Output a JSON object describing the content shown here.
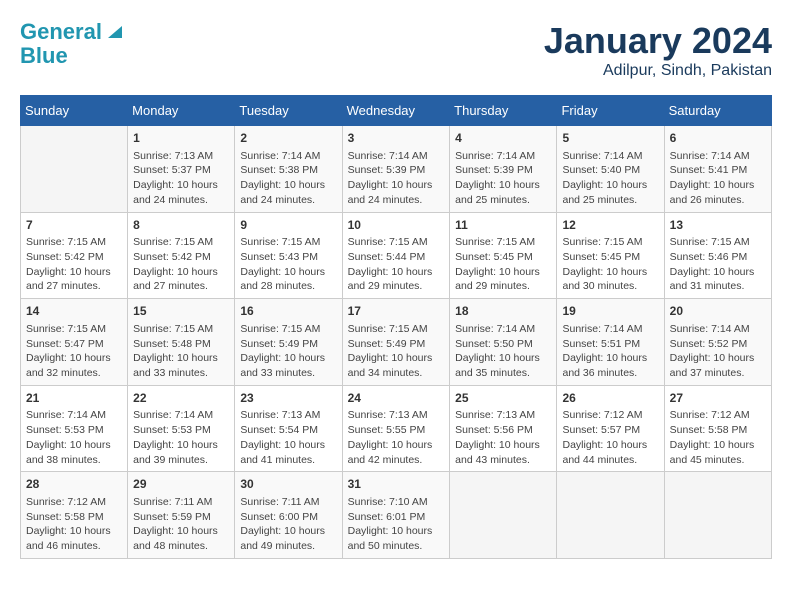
{
  "header": {
    "logo_line1": "General",
    "logo_line2": "Blue",
    "title": "January 2024",
    "subtitle": "Adilpur, Sindh, Pakistan"
  },
  "weekdays": [
    "Sunday",
    "Monday",
    "Tuesday",
    "Wednesday",
    "Thursday",
    "Friday",
    "Saturday"
  ],
  "weeks": [
    [
      {
        "day": "",
        "sunrise": "",
        "sunset": "",
        "daylight": ""
      },
      {
        "day": "1",
        "sunrise": "7:13 AM",
        "sunset": "5:37 PM",
        "daylight": "10 hours and 24 minutes."
      },
      {
        "day": "2",
        "sunrise": "7:14 AM",
        "sunset": "5:38 PM",
        "daylight": "10 hours and 24 minutes."
      },
      {
        "day": "3",
        "sunrise": "7:14 AM",
        "sunset": "5:39 PM",
        "daylight": "10 hours and 24 minutes."
      },
      {
        "day": "4",
        "sunrise": "7:14 AM",
        "sunset": "5:39 PM",
        "daylight": "10 hours and 25 minutes."
      },
      {
        "day": "5",
        "sunrise": "7:14 AM",
        "sunset": "5:40 PM",
        "daylight": "10 hours and 25 minutes."
      },
      {
        "day": "6",
        "sunrise": "7:14 AM",
        "sunset": "5:41 PM",
        "daylight": "10 hours and 26 minutes."
      }
    ],
    [
      {
        "day": "7",
        "sunrise": "7:15 AM",
        "sunset": "5:42 PM",
        "daylight": "10 hours and 27 minutes."
      },
      {
        "day": "8",
        "sunrise": "7:15 AM",
        "sunset": "5:42 PM",
        "daylight": "10 hours and 27 minutes."
      },
      {
        "day": "9",
        "sunrise": "7:15 AM",
        "sunset": "5:43 PM",
        "daylight": "10 hours and 28 minutes."
      },
      {
        "day": "10",
        "sunrise": "7:15 AM",
        "sunset": "5:44 PM",
        "daylight": "10 hours and 29 minutes."
      },
      {
        "day": "11",
        "sunrise": "7:15 AM",
        "sunset": "5:45 PM",
        "daylight": "10 hours and 29 minutes."
      },
      {
        "day": "12",
        "sunrise": "7:15 AM",
        "sunset": "5:45 PM",
        "daylight": "10 hours and 30 minutes."
      },
      {
        "day": "13",
        "sunrise": "7:15 AM",
        "sunset": "5:46 PM",
        "daylight": "10 hours and 31 minutes."
      }
    ],
    [
      {
        "day": "14",
        "sunrise": "7:15 AM",
        "sunset": "5:47 PM",
        "daylight": "10 hours and 32 minutes."
      },
      {
        "day": "15",
        "sunrise": "7:15 AM",
        "sunset": "5:48 PM",
        "daylight": "10 hours and 33 minutes."
      },
      {
        "day": "16",
        "sunrise": "7:15 AM",
        "sunset": "5:49 PM",
        "daylight": "10 hours and 33 minutes."
      },
      {
        "day": "17",
        "sunrise": "7:15 AM",
        "sunset": "5:49 PM",
        "daylight": "10 hours and 34 minutes."
      },
      {
        "day": "18",
        "sunrise": "7:14 AM",
        "sunset": "5:50 PM",
        "daylight": "10 hours and 35 minutes."
      },
      {
        "day": "19",
        "sunrise": "7:14 AM",
        "sunset": "5:51 PM",
        "daylight": "10 hours and 36 minutes."
      },
      {
        "day": "20",
        "sunrise": "7:14 AM",
        "sunset": "5:52 PM",
        "daylight": "10 hours and 37 minutes."
      }
    ],
    [
      {
        "day": "21",
        "sunrise": "7:14 AM",
        "sunset": "5:53 PM",
        "daylight": "10 hours and 38 minutes."
      },
      {
        "day": "22",
        "sunrise": "7:14 AM",
        "sunset": "5:53 PM",
        "daylight": "10 hours and 39 minutes."
      },
      {
        "day": "23",
        "sunrise": "7:13 AM",
        "sunset": "5:54 PM",
        "daylight": "10 hours and 41 minutes."
      },
      {
        "day": "24",
        "sunrise": "7:13 AM",
        "sunset": "5:55 PM",
        "daylight": "10 hours and 42 minutes."
      },
      {
        "day": "25",
        "sunrise": "7:13 AM",
        "sunset": "5:56 PM",
        "daylight": "10 hours and 43 minutes."
      },
      {
        "day": "26",
        "sunrise": "7:12 AM",
        "sunset": "5:57 PM",
        "daylight": "10 hours and 44 minutes."
      },
      {
        "day": "27",
        "sunrise": "7:12 AM",
        "sunset": "5:58 PM",
        "daylight": "10 hours and 45 minutes."
      }
    ],
    [
      {
        "day": "28",
        "sunrise": "7:12 AM",
        "sunset": "5:58 PM",
        "daylight": "10 hours and 46 minutes."
      },
      {
        "day": "29",
        "sunrise": "7:11 AM",
        "sunset": "5:59 PM",
        "daylight": "10 hours and 48 minutes."
      },
      {
        "day": "30",
        "sunrise": "7:11 AM",
        "sunset": "6:00 PM",
        "daylight": "10 hours and 49 minutes."
      },
      {
        "day": "31",
        "sunrise": "7:10 AM",
        "sunset": "6:01 PM",
        "daylight": "10 hours and 50 minutes."
      },
      {
        "day": "",
        "sunrise": "",
        "sunset": "",
        "daylight": ""
      },
      {
        "day": "",
        "sunrise": "",
        "sunset": "",
        "daylight": ""
      },
      {
        "day": "",
        "sunrise": "",
        "sunset": "",
        "daylight": ""
      }
    ]
  ]
}
